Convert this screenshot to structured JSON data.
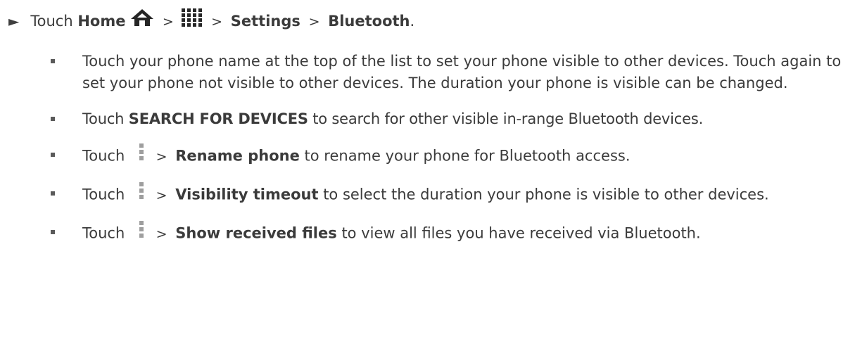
{
  "step": {
    "bullet_symbol": "►",
    "touch": "Touch",
    "home": "Home",
    "sep": ">",
    "settings": "Settings",
    "bluetooth": "Bluetooth",
    "end": ".",
    "icons": [
      "home-icon",
      "apps-grid-icon"
    ]
  },
  "bullets": [
    {
      "text": "Touch your phone name at the top of the list to set your phone visible to other devices. Touch again to set your phone not visible to other devices. The duration your phone is visible can be changed."
    },
    {
      "pre": "Touch",
      "bold": "SEARCH FOR DEVICES",
      "post": "to search for other visible in-range Bluetooth devices."
    },
    {
      "pre": "Touch",
      "sep": ">",
      "bold": "Rename phone",
      "post": "to rename your phone for Bluetooth access.",
      "icon": "more-options-icon"
    },
    {
      "pre": "Touch",
      "sep": ">",
      "bold": "Visibility timeout",
      "post": "to select the duration your phone is visible to other devices.",
      "icon": "more-options-icon"
    },
    {
      "pre": "Touch",
      "sep": ">",
      "bold": "Show received files",
      "post": "to view all files you have received via Bluetooth.",
      "icon": "more-options-icon"
    }
  ],
  "colors": {
    "text": "#3b3b3b",
    "icon": "#262626",
    "menu_icon": "#9e9e9e"
  }
}
